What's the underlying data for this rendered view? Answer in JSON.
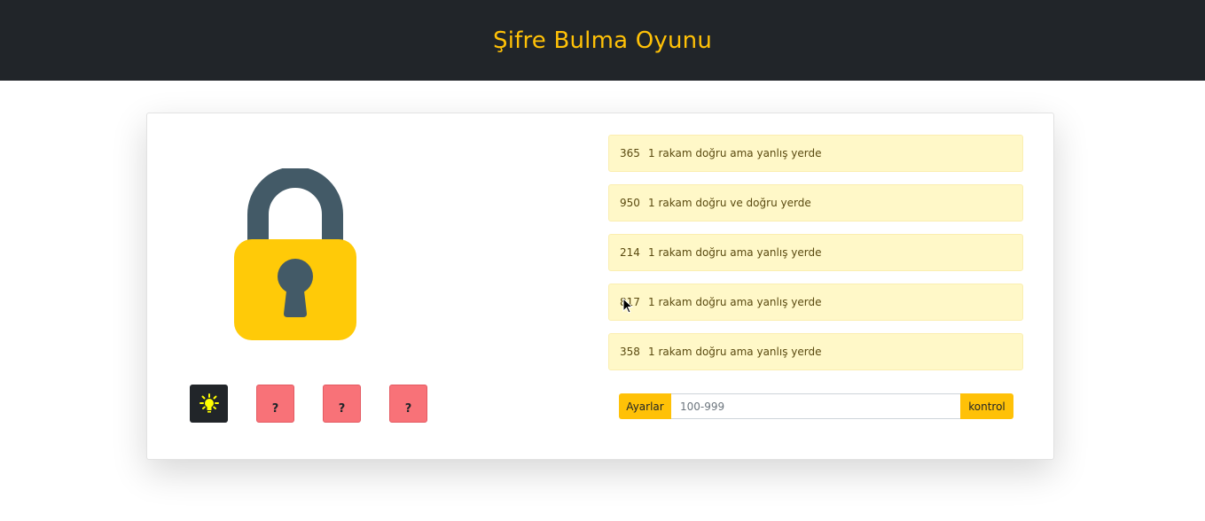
{
  "header": {
    "title": "Şifre Bulma Oyunu"
  },
  "hints": {
    "lightbulb_icon": "lightbulb-icon",
    "slots": [
      "?",
      "?",
      "?"
    ]
  },
  "guesses": [
    {
      "number": "365",
      "result": "1 rakam doğru ama yanlış yerde"
    },
    {
      "number": "950",
      "result": "1 rakam doğru ve doğru yerde"
    },
    {
      "number": "214",
      "result": "1 rakam doğru ama yanlış yerde"
    },
    {
      "number": "817",
      "result": "1 rakam doğru ama yanlış yerde"
    },
    {
      "number": "358",
      "result": "1 rakam doğru ama yanlış yerde"
    }
  ],
  "controls": {
    "settings_label": "Ayarlar",
    "input_placeholder": "100-999",
    "input_value": "",
    "check_label": "kontrol"
  },
  "colors": {
    "accent": "#ffc107",
    "header_bg": "#212529",
    "guess_bg": "#fff8c8",
    "hint_slot": "#f87278",
    "lock_shackle": "#435a67"
  }
}
